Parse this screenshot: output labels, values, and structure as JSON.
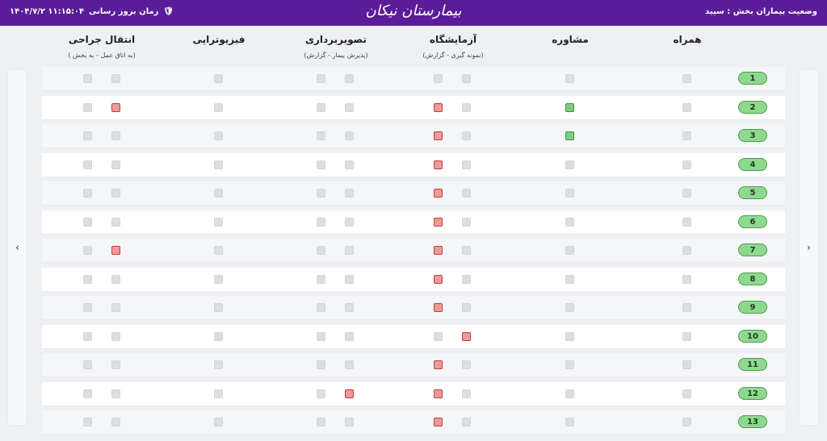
{
  "header": {
    "ward_label": "وضعیت بیماران بخش : سپید",
    "update_label": "زمان بروز رسانی",
    "update_time": "۱۴۰۴/۷/۲ ۱۱:۱۵:۰۴",
    "logo_text": "بیمارستان نیکان"
  },
  "columns": {
    "companion": "همراه",
    "consult": "مشاوره",
    "lab": "آزمایشگاه",
    "lab_sub": "(نمونه گیری - گزارش)",
    "imaging": "تصویربرداری",
    "imaging_sub": "(پذیرش بیمار - گزارش)",
    "physio": "فیزیوتراپی",
    "surgery": "انتقال جراحی",
    "surgery_sub": "( به اتاق عمل - به بخش)"
  },
  "nav": {
    "prev": "›",
    "next": "‹"
  },
  "colors": {
    "header_bg": "#5b1c99",
    "red": "#ee9a9a",
    "green": "#7fcc7f",
    "gray": "#dcdee1"
  },
  "rows": [
    {
      "bed": "1",
      "companion": "gray",
      "consult": "gray",
      "lab": [
        "gray",
        "gray"
      ],
      "imaging": [
        "gray",
        "gray"
      ],
      "physio": "gray",
      "surgery": [
        "gray",
        "gray"
      ]
    },
    {
      "bed": "2",
      "companion": "gray",
      "consult": "green",
      "lab": [
        "gray",
        "red"
      ],
      "imaging": [
        "gray",
        "gray"
      ],
      "physio": "gray",
      "surgery": [
        "red",
        "gray"
      ]
    },
    {
      "bed": "3",
      "companion": "gray",
      "consult": "green",
      "lab": [
        "gray",
        "red"
      ],
      "imaging": [
        "gray",
        "gray"
      ],
      "physio": "gray",
      "surgery": [
        "gray",
        "gray"
      ]
    },
    {
      "bed": "4",
      "companion": "gray",
      "consult": "gray",
      "lab": [
        "gray",
        "red"
      ],
      "imaging": [
        "gray",
        "gray"
      ],
      "physio": "gray",
      "surgery": [
        "gray",
        "gray"
      ]
    },
    {
      "bed": "5",
      "companion": "gray",
      "consult": "gray",
      "lab": [
        "gray",
        "red"
      ],
      "imaging": [
        "gray",
        "gray"
      ],
      "physio": "gray",
      "surgery": [
        "gray",
        "gray"
      ]
    },
    {
      "bed": "6",
      "companion": "gray",
      "consult": "gray",
      "lab": [
        "gray",
        "red"
      ],
      "imaging": [
        "gray",
        "gray"
      ],
      "physio": "gray",
      "surgery": [
        "gray",
        "gray"
      ]
    },
    {
      "bed": "7",
      "companion": "gray",
      "consult": "gray",
      "lab": [
        "gray",
        "red"
      ],
      "imaging": [
        "gray",
        "gray"
      ],
      "physio": "gray",
      "surgery": [
        "red",
        "gray"
      ]
    },
    {
      "bed": "8",
      "companion": "gray",
      "consult": "gray",
      "lab": [
        "gray",
        "red"
      ],
      "imaging": [
        "gray",
        "gray"
      ],
      "physio": "gray",
      "surgery": [
        "gray",
        "gray"
      ]
    },
    {
      "bed": "9",
      "companion": "gray",
      "consult": "gray",
      "lab": [
        "gray",
        "red"
      ],
      "imaging": [
        "gray",
        "gray"
      ],
      "physio": "gray",
      "surgery": [
        "gray",
        "gray"
      ]
    },
    {
      "bed": "10",
      "companion": "gray",
      "consult": "gray",
      "lab": [
        "red",
        "gray"
      ],
      "imaging": [
        "gray",
        "gray"
      ],
      "physio": "gray",
      "surgery": [
        "gray",
        "gray"
      ]
    },
    {
      "bed": "11",
      "companion": "gray",
      "consult": "gray",
      "lab": [
        "gray",
        "red"
      ],
      "imaging": [
        "gray",
        "gray"
      ],
      "physio": "gray",
      "surgery": [
        "gray",
        "gray"
      ]
    },
    {
      "bed": "12",
      "companion": "gray",
      "consult": "gray",
      "lab": [
        "gray",
        "red"
      ],
      "imaging": [
        "gray",
        "red"
      ],
      "physio": "gray",
      "surgery": [
        "gray",
        "gray"
      ]
    },
    {
      "bed": "13",
      "companion": "gray",
      "consult": "gray",
      "lab": [
        "gray",
        "red"
      ],
      "imaging": [
        "gray",
        "gray"
      ],
      "physio": "gray",
      "surgery": [
        "gray",
        "gray"
      ]
    }
  ]
}
